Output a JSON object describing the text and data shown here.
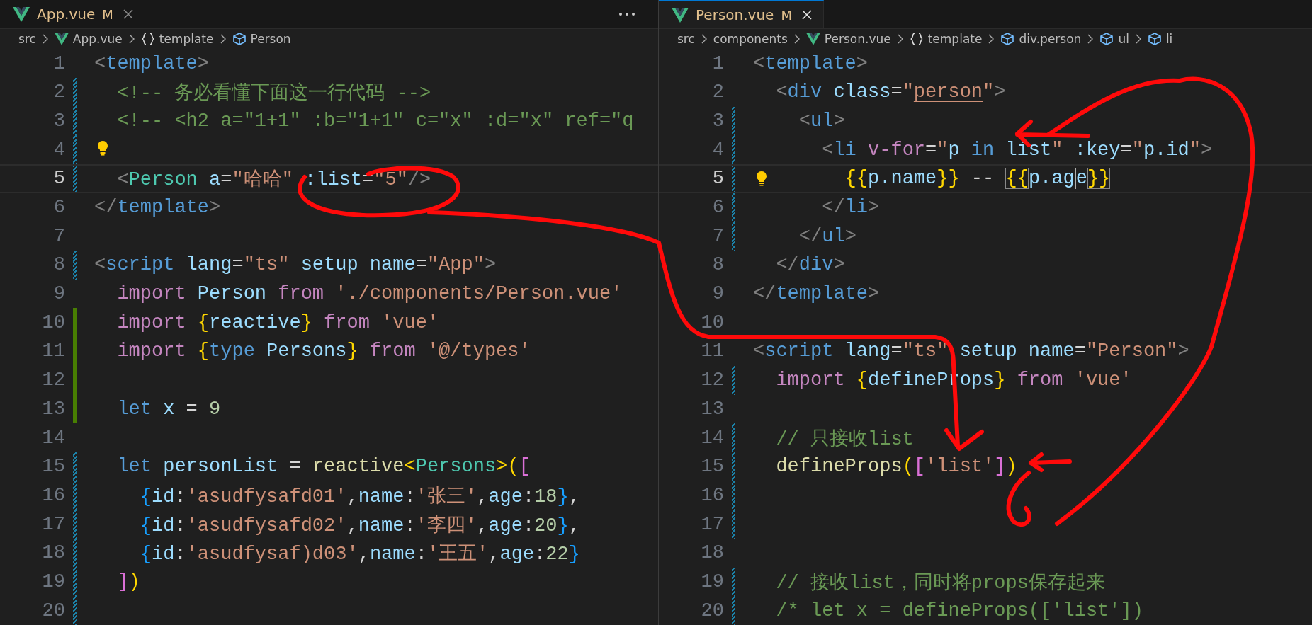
{
  "panes": [
    {
      "tab": {
        "name": "App.vue",
        "status": "M",
        "selected": false
      },
      "breadcrumbs": [
        {
          "kind": "folder",
          "label": "src"
        },
        {
          "kind": "file",
          "label": "App.vue"
        },
        {
          "kind": "section",
          "label": "template"
        },
        {
          "kind": "element",
          "label": "Person"
        }
      ],
      "more": true,
      "lines": [
        {
          "number": "1",
          "kind": "plain",
          "tokens": [
            {
              "text": "<",
              "kind": "p"
            },
            {
              "text": "template",
              "kind": "tag"
            },
            {
              "text": ">",
              "kind": "p"
            }
          ]
        },
        {
          "number": "2",
          "kind": "modified",
          "tokens": [
            {
              "text": "  <!-- 务必看懂下面这一行代码 -->",
              "kind": "com"
            }
          ]
        },
        {
          "number": "3",
          "kind": "modified",
          "tokens": [
            {
              "text": "  <!-- <h2 a=\"1+1\" :b=\"1+1\" c=\"x\" :d=\"x\" ref=\"q",
              "kind": "com"
            }
          ]
        },
        {
          "number": "4",
          "kind": "modified",
          "lightbulb": true
        },
        {
          "number": "5",
          "kind": "modified",
          "current": true,
          "tokens": [
            {
              "text": "  <",
              "kind": "p"
            },
            {
              "text": "Person",
              "kind": "type"
            },
            {
              "text": " a",
              "kind": "attr"
            },
            {
              "text": "=",
              "kind": "txt"
            },
            {
              "text": "\"哈哈\"",
              "kind": "str"
            },
            {
              "text": " :list",
              "kind": "attr"
            },
            {
              "text": "=",
              "kind": "txt"
            },
            {
              "text": "\"5\"",
              "kind": "str"
            },
            {
              "text": "/>",
              "kind": "p"
            }
          ]
        },
        {
          "number": "6",
          "kind": "plain",
          "tokens": [
            {
              "text": "</",
              "kind": "p"
            },
            {
              "text": "template",
              "kind": "tag"
            },
            {
              "text": ">",
              "kind": "p"
            }
          ]
        },
        {
          "number": "7",
          "kind": "plain"
        },
        {
          "number": "8",
          "kind": "modified",
          "tokens": [
            {
              "text": "<",
              "kind": "p"
            },
            {
              "text": "script",
              "kind": "tag"
            },
            {
              "text": " lang",
              "kind": "attr"
            },
            {
              "text": "=",
              "kind": "txt"
            },
            {
              "text": "\"ts\"",
              "kind": "str"
            },
            {
              "text": " setup name",
              "kind": "attr"
            },
            {
              "text": "=",
              "kind": "txt"
            },
            {
              "text": "\"App\"",
              "kind": "str"
            },
            {
              "text": ">",
              "kind": "p"
            }
          ]
        },
        {
          "number": "9",
          "kind": "plain",
          "tokens": [
            {
              "text": "  import",
              "kind": "kw"
            },
            {
              "text": " Person",
              "kind": "var"
            },
            {
              "text": " from",
              "kind": "kw"
            },
            {
              "text": " './components/Person.vue'",
              "kind": "str"
            }
          ]
        },
        {
          "number": "10",
          "kind": "added",
          "tokens": [
            {
              "text": "  import",
              "kind": "kw"
            },
            {
              "text": " {",
              "kind": "b1"
            },
            {
              "text": "reactive",
              "kind": "var"
            },
            {
              "text": "}",
              "kind": "b1"
            },
            {
              "text": " from",
              "kind": "kw"
            },
            {
              "text": " 'vue'",
              "kind": "str"
            }
          ]
        },
        {
          "number": "11",
          "kind": "added",
          "tokens": [
            {
              "text": "  import",
              "kind": "kw"
            },
            {
              "text": " {",
              "kind": "b1"
            },
            {
              "text": "type",
              "kind": "stor"
            },
            {
              "text": " Persons",
              "kind": "var"
            },
            {
              "text": "}",
              "kind": "b1"
            },
            {
              "text": " from",
              "kind": "kw"
            },
            {
              "text": " '@/types'",
              "kind": "str"
            }
          ]
        },
        {
          "number": "12",
          "kind": "added"
        },
        {
          "number": "13",
          "kind": "added",
          "tokens": [
            {
              "text": "  let",
              "kind": "stor"
            },
            {
              "text": " x",
              "kind": "var"
            },
            {
              "text": " = ",
              "kind": "txt"
            },
            {
              "text": "9",
              "kind": "num"
            }
          ]
        },
        {
          "number": "14",
          "kind": "plain"
        },
        {
          "number": "15",
          "kind": "modified",
          "tokens": [
            {
              "text": "  let",
              "kind": "stor"
            },
            {
              "text": " personList",
              "kind": "var"
            },
            {
              "text": " = ",
              "kind": "txt"
            },
            {
              "text": "reactive",
              "kind": "fn"
            },
            {
              "text": "<",
              "kind": "b1"
            },
            {
              "text": "Persons",
              "kind": "type"
            },
            {
              "text": ">",
              "kind": "b1"
            },
            {
              "text": "(",
              "kind": "b1"
            },
            {
              "text": "[",
              "kind": "b2"
            }
          ]
        },
        {
          "number": "16",
          "kind": "modified",
          "tokens": [
            {
              "text": "    {",
              "kind": "b3"
            },
            {
              "text": "id",
              "kind": "var"
            },
            {
              "text": ":",
              "kind": "txt"
            },
            {
              "text": "'asudfysafd01'",
              "kind": "str"
            },
            {
              "text": ",",
              "kind": "txt"
            },
            {
              "text": "name",
              "kind": "var"
            },
            {
              "text": ":",
              "kind": "txt"
            },
            {
              "text": "'张三'",
              "kind": "str"
            },
            {
              "text": ",",
              "kind": "txt"
            },
            {
              "text": "age",
              "kind": "var"
            },
            {
              "text": ":",
              "kind": "txt"
            },
            {
              "text": "18",
              "kind": "num"
            },
            {
              "text": "}",
              "kind": "b3"
            },
            {
              "text": ",",
              "kind": "txt"
            }
          ]
        },
        {
          "number": "17",
          "kind": "modified",
          "tokens": [
            {
              "text": "    {",
              "kind": "b3"
            },
            {
              "text": "id",
              "kind": "var"
            },
            {
              "text": ":",
              "kind": "txt"
            },
            {
              "text": "'asudfysafd02'",
              "kind": "str"
            },
            {
              "text": ",",
              "kind": "txt"
            },
            {
              "text": "name",
              "kind": "var"
            },
            {
              "text": ":",
              "kind": "txt"
            },
            {
              "text": "'李四'",
              "kind": "str"
            },
            {
              "text": ",",
              "kind": "txt"
            },
            {
              "text": "age",
              "kind": "var"
            },
            {
              "text": ":",
              "kind": "txt"
            },
            {
              "text": "20",
              "kind": "num"
            },
            {
              "text": "}",
              "kind": "b3"
            },
            {
              "text": ",",
              "kind": "txt"
            }
          ]
        },
        {
          "number": "18",
          "kind": "modified",
          "tokens": [
            {
              "text": "    {",
              "kind": "b3"
            },
            {
              "text": "id",
              "kind": "var"
            },
            {
              "text": ":",
              "kind": "txt"
            },
            {
              "text": "'asudfysaf)d03'",
              "kind": "str"
            },
            {
              "text": ",",
              "kind": "txt"
            },
            {
              "text": "name",
              "kind": "var"
            },
            {
              "text": ":",
              "kind": "txt"
            },
            {
              "text": "'王五'",
              "kind": "str"
            },
            {
              "text": ",",
              "kind": "txt"
            },
            {
              "text": "age",
              "kind": "var"
            },
            {
              "text": ":",
              "kind": "txt"
            },
            {
              "text": "22",
              "kind": "num"
            },
            {
              "text": "}",
              "kind": "b3"
            }
          ]
        },
        {
          "number": "19",
          "kind": "modified",
          "tokens": [
            {
              "text": "  ]",
              "kind": "b2"
            },
            {
              "text": ")",
              "kind": "b1"
            }
          ]
        },
        {
          "number": "20",
          "kind": "modified"
        }
      ]
    },
    {
      "tab": {
        "name": "Person.vue",
        "status": "M",
        "selected": true
      },
      "breadcrumbs": [
        {
          "kind": "folder",
          "label": "src"
        },
        {
          "kind": "folder",
          "label": "components"
        },
        {
          "kind": "file",
          "label": "Person.vue"
        },
        {
          "kind": "section",
          "label": "template"
        },
        {
          "kind": "element",
          "label": "div.person"
        },
        {
          "kind": "element",
          "label": "ul"
        },
        {
          "kind": "element",
          "label": "li"
        }
      ],
      "more": false,
      "lines": [
        {
          "number": "1",
          "kind": "plain",
          "tokens": [
            {
              "text": "<",
              "kind": "p"
            },
            {
              "text": "template",
              "kind": "tag"
            },
            {
              "text": ">",
              "kind": "p"
            }
          ]
        },
        {
          "number": "2",
          "kind": "plain",
          "tokens": [
            {
              "text": "  <",
              "kind": "p"
            },
            {
              "text": "div",
              "kind": "tag"
            },
            {
              "text": " class",
              "kind": "attr"
            },
            {
              "text": "=",
              "kind": "txt"
            },
            {
              "text": "\"",
              "kind": "str"
            },
            {
              "text": "person",
              "kind": "str",
              "underline": true
            },
            {
              "text": "\"",
              "kind": "str"
            },
            {
              "text": ">",
              "kind": "p"
            }
          ]
        },
        {
          "number": "3",
          "kind": "modified",
          "tokens": [
            {
              "text": "    <",
              "kind": "p"
            },
            {
              "text": "ul",
              "kind": "tag"
            },
            {
              "text": ">",
              "kind": "p"
            }
          ]
        },
        {
          "number": "4",
          "kind": "modified",
          "tokens": [
            {
              "text": "      <",
              "kind": "p"
            },
            {
              "text": "li",
              "kind": "tag"
            },
            {
              "text": " v-for",
              "kind": "kw"
            },
            {
              "text": "=",
              "kind": "txt"
            },
            {
              "text": "\"",
              "kind": "str"
            },
            {
              "text": "p",
              "kind": "var"
            },
            {
              "text": " in",
              "kind": "stor"
            },
            {
              "text": " list",
              "kind": "var"
            },
            {
              "text": "\"",
              "kind": "str"
            },
            {
              "text": " :key",
              "kind": "attr"
            },
            {
              "text": "=",
              "kind": "txt"
            },
            {
              "text": "\"",
              "kind": "str"
            },
            {
              "text": "p.id",
              "kind": "var"
            },
            {
              "text": "\"",
              "kind": "str"
            },
            {
              "text": ">",
              "kind": "p"
            }
          ]
        },
        {
          "number": "5",
          "kind": "modified",
          "current": true,
          "lightbulb": true,
          "tokens": [
            {
              "text": "        {{",
              "kind": "b1",
              "boxed": false
            },
            {
              "text": "p.name",
              "kind": "var"
            },
            {
              "text": "}}",
              "kind": "b1",
              "boxed": false
            },
            {
              "text": " -- ",
              "kind": "txt"
            },
            {
              "text": "{{",
              "kind": "b1",
              "boxed": true
            },
            {
              "text": "p.ag",
              "kind": "var",
              "cursor": true
            },
            {
              "text": "e",
              "kind": "var"
            },
            {
              "text": "}}",
              "kind": "b1",
              "boxed": true
            }
          ]
        },
        {
          "number": "6",
          "kind": "modified",
          "tokens": [
            {
              "text": "      </",
              "kind": "p"
            },
            {
              "text": "li",
              "kind": "tag"
            },
            {
              "text": ">",
              "kind": "p"
            }
          ]
        },
        {
          "number": "7",
          "kind": "modified",
          "tokens": [
            {
              "text": "    </",
              "kind": "p"
            },
            {
              "text": "ul",
              "kind": "tag"
            },
            {
              "text": ">",
              "kind": "p"
            }
          ]
        },
        {
          "number": "8",
          "kind": "plain",
          "tokens": [
            {
              "text": "  </",
              "kind": "p"
            },
            {
              "text": "div",
              "kind": "tag"
            },
            {
              "text": ">",
              "kind": "p"
            }
          ]
        },
        {
          "number": "9",
          "kind": "plain",
          "tokens": [
            {
              "text": "</",
              "kind": "p"
            },
            {
              "text": "template",
              "kind": "tag"
            },
            {
              "text": ">",
              "kind": "p"
            }
          ]
        },
        {
          "number": "10",
          "kind": "plain"
        },
        {
          "number": "11",
          "kind": "plain",
          "tokens": [
            {
              "text": "<",
              "kind": "p"
            },
            {
              "text": "script",
              "kind": "tag"
            },
            {
              "text": " lang",
              "kind": "attr"
            },
            {
              "text": "=",
              "kind": "txt"
            },
            {
              "text": "\"ts\"",
              "kind": "str"
            },
            {
              "text": " setup name",
              "kind": "attr"
            },
            {
              "text": "=",
              "kind": "txt"
            },
            {
              "text": "\"Person\"",
              "kind": "str"
            },
            {
              "text": ">",
              "kind": "p"
            }
          ]
        },
        {
          "number": "12",
          "kind": "modified",
          "tokens": [
            {
              "text": "  import",
              "kind": "kw"
            },
            {
              "text": " {",
              "kind": "b1"
            },
            {
              "text": "defineProps",
              "kind": "var"
            },
            {
              "text": "}",
              "kind": "b1"
            },
            {
              "text": " from",
              "kind": "kw"
            },
            {
              "text": " 'vue'",
              "kind": "str"
            }
          ]
        },
        {
          "number": "13",
          "kind": "plain"
        },
        {
          "number": "14",
          "kind": "modified",
          "tokens": [
            {
              "text": "  // 只接收list",
              "kind": "com"
            }
          ]
        },
        {
          "number": "15",
          "kind": "modified",
          "tokens": [
            {
              "text": "  defineProps",
              "kind": "fn"
            },
            {
              "text": "(",
              "kind": "b1"
            },
            {
              "text": "[",
              "kind": "b2"
            },
            {
              "text": "'list'",
              "kind": "str"
            },
            {
              "text": "]",
              "kind": "b2"
            },
            {
              "text": ")",
              "kind": "b1"
            }
          ]
        },
        {
          "number": "16",
          "kind": "modified"
        },
        {
          "number": "17",
          "kind": "modified"
        },
        {
          "number": "18",
          "kind": "plain"
        },
        {
          "number": "19",
          "kind": "modified",
          "tokens": [
            {
              "text": "  // 接收list，同时将props保存起来",
              "kind": "com"
            }
          ]
        },
        {
          "number": "20",
          "kind": "modified",
          "tokens": [
            {
              "text": "  /* let x = defineProps(['list'])",
              "kind": "com"
            }
          ]
        }
      ]
    }
  ]
}
